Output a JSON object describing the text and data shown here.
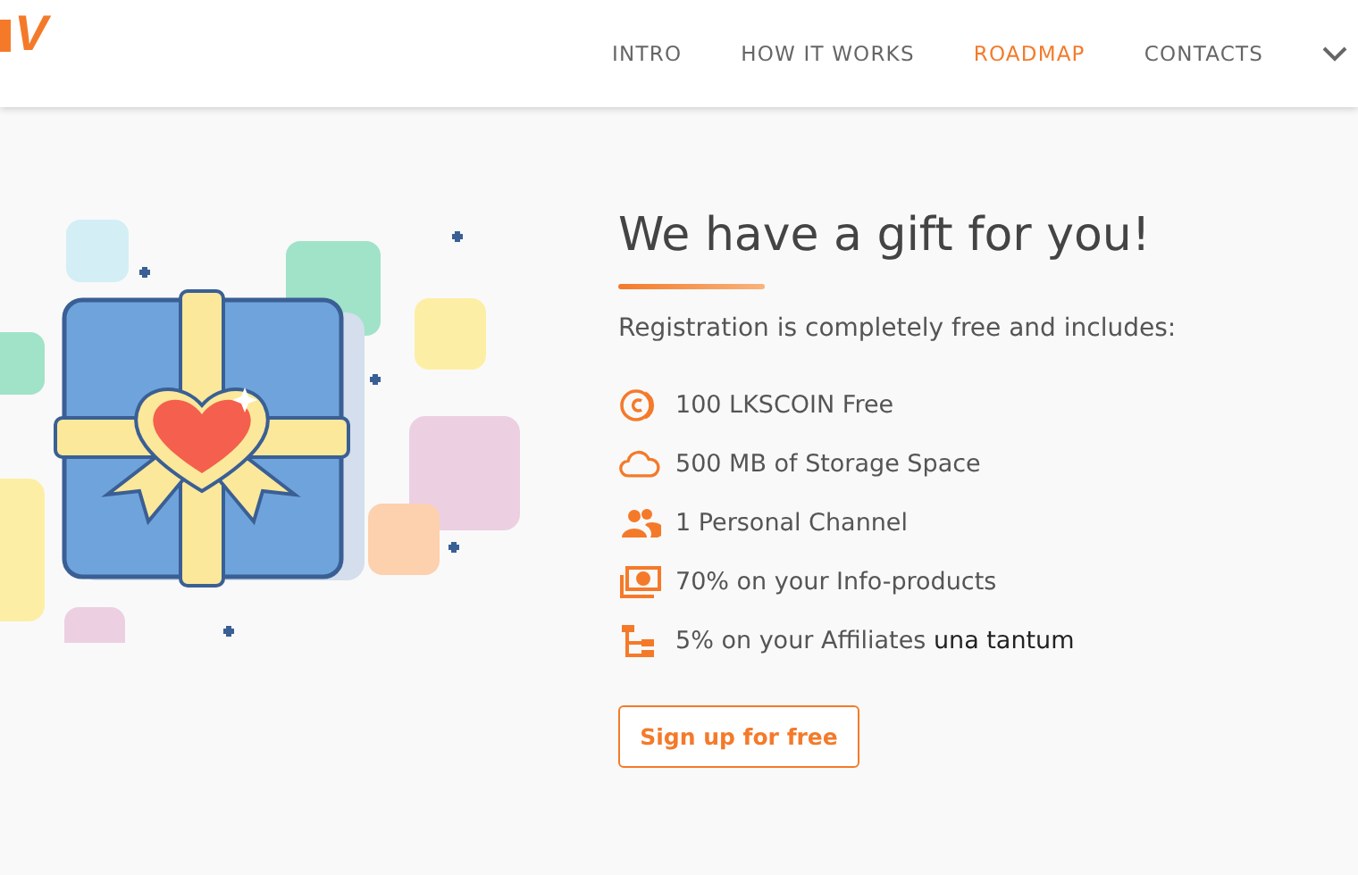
{
  "header": {
    "logo": "V",
    "nav": [
      {
        "label": "INTRO",
        "selected": false
      },
      {
        "label": "HOW IT WORKS",
        "selected": false
      },
      {
        "label": "ROADMAP",
        "selected": true
      },
      {
        "label": "CONTACTS",
        "selected": false
      }
    ]
  },
  "offer": {
    "title": "We have a gift for you!",
    "subtitle": "Registration is completely free and includes:",
    "features": [
      {
        "kind": "coin",
        "text": "100 LKSCOIN Free"
      },
      {
        "kind": "cloud",
        "text": "500 MB of Storage Space"
      },
      {
        "kind": "people",
        "text": "1 Personal Channel"
      },
      {
        "kind": "money",
        "text": "70% on your Info-products"
      },
      {
        "kind": "tree",
        "text": "5% on your Affiliates **una tantum**"
      }
    ],
    "button": "Sign up for free"
  }
}
